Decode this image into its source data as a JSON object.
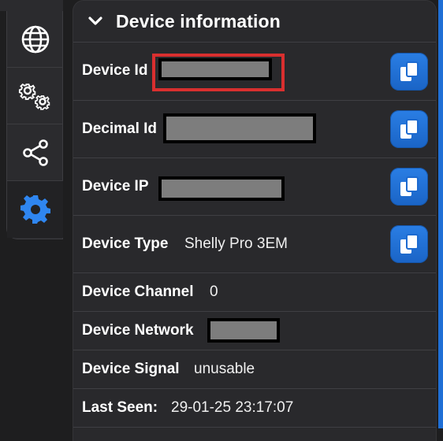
{
  "panel": {
    "title": "Device information"
  },
  "rail": {
    "items": [
      {
        "icon": "globe-icon"
      },
      {
        "icon": "gears-icon"
      },
      {
        "icon": "share-icon"
      },
      {
        "icon": "gear-icon",
        "active": true
      }
    ]
  },
  "fields": {
    "device_id": {
      "label": "Device Id"
    },
    "decimal_id": {
      "label": "Decimal Id"
    },
    "device_ip": {
      "label": "Device IP"
    },
    "device_type": {
      "label": "Device Type",
      "value": "Shelly Pro 3EM"
    },
    "device_channel": {
      "label": "Device Channel",
      "value": "0"
    },
    "device_network": {
      "label": "Device Network"
    },
    "device_signal": {
      "label": "Device Signal",
      "value": "unusable"
    },
    "last_seen": {
      "label": "Last Seen:",
      "value": "29-01-25 23:17:07"
    }
  },
  "colors": {
    "accent": "#1f6fd6",
    "active_icon": "#2f86f0",
    "highlight": "#d92f2f",
    "redaction": "#7d7d7d"
  }
}
